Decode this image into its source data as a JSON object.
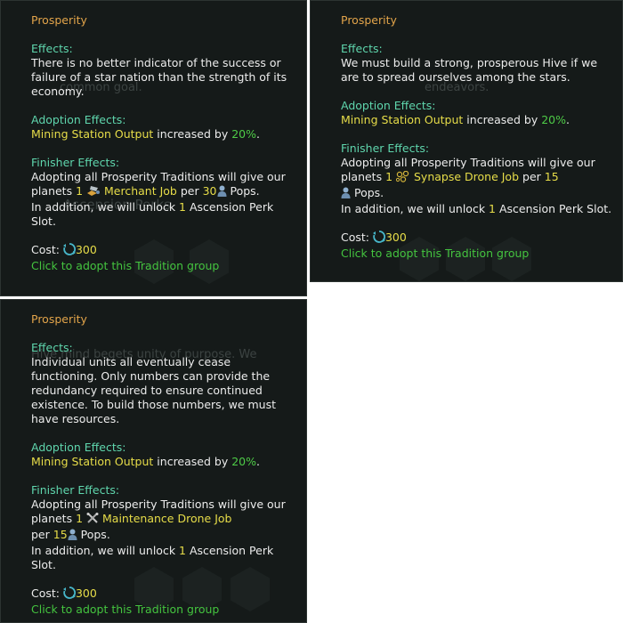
{
  "colors": {
    "title": "#e2a44a",
    "heading": "#5fd6ad",
    "highlight_yellow": "#e7dd49",
    "highlight_green": "#4ecb47",
    "body_text": "#ececec",
    "panel_bg": "#151a19"
  },
  "tooltips": [
    {
      "title": "Prosperity",
      "effects_heading": "Effects:",
      "effects_text": "There is no better indicator of the success or failure of a star nation than the strength of its economy.",
      "adoption_heading": "Adoption Effects:",
      "adoption_target": "Mining Station Output",
      "adoption_mid": " increased by ",
      "adoption_value": "20%",
      "adoption_end": ".",
      "finisher_heading": "Finisher Effects:",
      "finisher_pre": "Adopting all Prosperity Traditions will give our planets ",
      "job_count": "1",
      "job_icon": "merchant-icon",
      "job_name": "Merchant Job",
      "per_text": " per ",
      "pop_count": "30",
      "pop_icon": "pop-icon",
      "pops_text": " Pops.",
      "unlock_pre": "In addition, we will unlock ",
      "unlock_count": "1",
      "unlock_post": " Ascension Perk Slot.",
      "cost_label": "Cost: ",
      "cost_icon": "unity-icon",
      "cost_value": "300",
      "adopt_link": "Click to adopt this Tradition group"
    },
    {
      "title": "Prosperity",
      "effects_heading": "Effects:",
      "effects_text": "We must build a strong, prosperous Hive if we are to spread ourselves among the stars.",
      "adoption_heading": "Adoption Effects:",
      "adoption_target": "Mining Station Output",
      "adoption_mid": " increased by ",
      "adoption_value": "20%",
      "adoption_end": ".",
      "finisher_heading": "Finisher Effects:",
      "finisher_pre": "Adopting all Prosperity Traditions will give our planets ",
      "job_count": "1",
      "job_icon": "synapse-drone-icon",
      "job_name": "Synapse Drone Job",
      "per_text": " per ",
      "pop_count": "15",
      "pop_icon": "pop-icon",
      "pops_text": " Pops.",
      "unlock_pre": "In addition, we will unlock ",
      "unlock_count": "1",
      "unlock_post": " Ascension Perk Slot.",
      "cost_label": "Cost: ",
      "cost_icon": "unity-icon",
      "cost_value": "300",
      "adopt_link": "Click to adopt this Tradition group"
    },
    {
      "title": "Prosperity",
      "effects_heading": "Effects:",
      "effects_text": "Individual units all eventually cease functioning. Only numbers can provide the redundancy required to ensure continued existence. To build those numbers, we must have resources.",
      "adoption_heading": "Adoption Effects:",
      "adoption_target": "Mining Station Output",
      "adoption_mid": " increased by ",
      "adoption_value": "20%",
      "adoption_end": ".",
      "finisher_heading": "Finisher Effects:",
      "finisher_pre": "Adopting all Prosperity Traditions will give our planets ",
      "job_count": "1",
      "job_icon": "maintenance-drone-icon",
      "job_name": "Maintenance Drone Job",
      "per_text": " per ",
      "pop_count": "15",
      "pop_icon": "pop-icon",
      "pops_text": " Pops.",
      "unlock_pre": "In addition, we will unlock ",
      "unlock_count": "1",
      "unlock_post": " Ascension Perk Slot.",
      "cost_label": "Cost: ",
      "cost_icon": "unity-icon",
      "cost_value": "300",
      "adopt_link": "Click to adopt this Tradition group"
    }
  ],
  "background": {
    "ghost_1": "common goal.",
    "ghost_2": "Ascension Perks",
    "ghost_3": "endeavors.",
    "ghost_4": "Hive mind begets unity of purpose. We"
  }
}
